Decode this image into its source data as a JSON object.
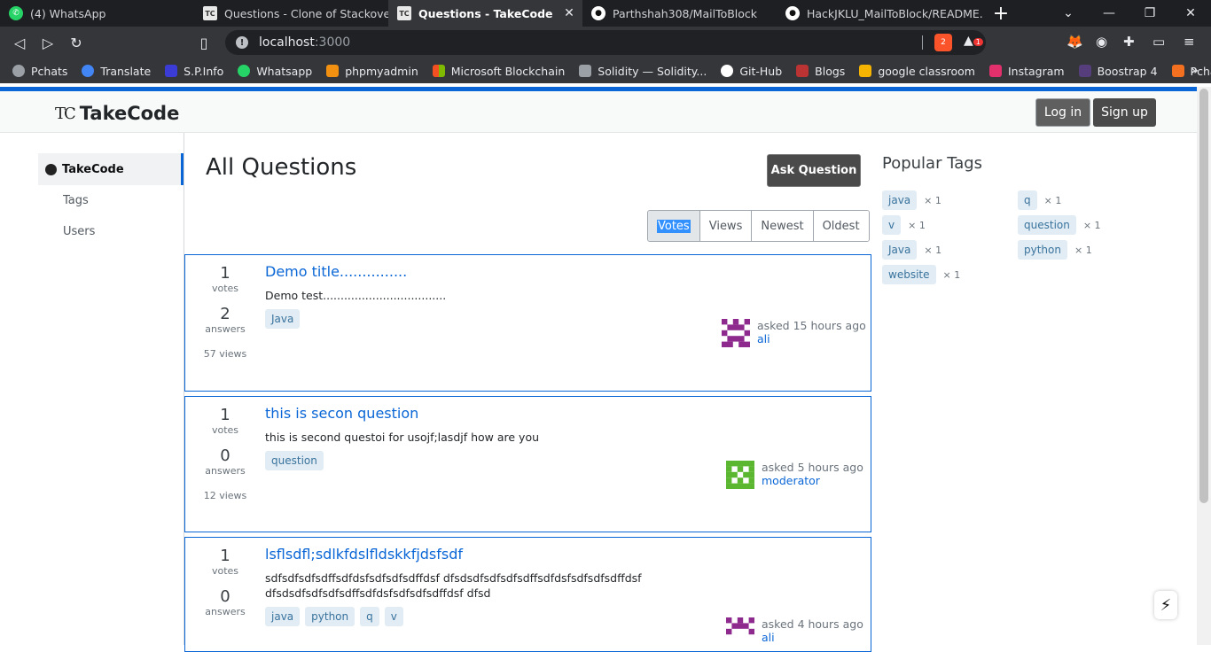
{
  "browser": {
    "tabs": [
      {
        "title": "(4) WhatsApp",
        "favicon": "whatsapp-icon"
      },
      {
        "title": "Questions - Clone of Stackoverflow",
        "favicon": "takecode-icon"
      },
      {
        "title": "Questions - TakeCode",
        "favicon": "takecode-icon",
        "active": true
      },
      {
        "title": "Parthshah308/MailToBlock",
        "favicon": "github-icon"
      },
      {
        "title": "HackJKLU_MailToBlock/README.m",
        "favicon": "github-icon"
      }
    ],
    "url_host": "localhost",
    "url_port": ":3000",
    "brave_count": "2",
    "rewards_count": "1",
    "bookmarks": [
      {
        "label": "Pchats",
        "color": "#9aa0a6"
      },
      {
        "label": "Translate",
        "color": "#4285f4"
      },
      {
        "label": "S.P.Info",
        "color": "#3b3bd6"
      },
      {
        "label": "Whatsapp",
        "color": "#25d366"
      },
      {
        "label": "phpmyadmin",
        "color": "#f29111"
      },
      {
        "label": "Microsoft Blockchain",
        "color": "#00a4ef"
      },
      {
        "label": "Solidity — Solidity...",
        "color": "#9aa0a6"
      },
      {
        "label": "Git-Hub",
        "color": "#ffffff"
      },
      {
        "label": "Blogs",
        "color": "#b33"
      },
      {
        "label": "google classroom",
        "color": "#f4b400"
      },
      {
        "label": "Instagram",
        "color": "#e1306c"
      },
      {
        "label": "Boostrap 4",
        "color": "#563d7c"
      },
      {
        "label": "Pchats",
        "color": "#f37021"
      }
    ]
  },
  "site": {
    "logo_mark": "TC",
    "logo_name": "TakeCode",
    "login": "Log in",
    "signup": "Sign up"
  },
  "nav": {
    "items": [
      "TakeCode",
      "Tags",
      "Users"
    ]
  },
  "main": {
    "title": "All Questions",
    "ask_button": "Ask Question",
    "sort": [
      "Votes",
      "Views",
      "Newest",
      "Oldest"
    ]
  },
  "questions": [
    {
      "votes": "1",
      "votes_label": "votes",
      "answers": "2",
      "answers_label": "answers",
      "views": "57 views",
      "title": "Demo title...............",
      "body": "Demo test...................................",
      "tags": [
        "Java"
      ],
      "asked": "asked 15 hours ago",
      "user": "ali"
    },
    {
      "votes": "1",
      "votes_label": "votes",
      "answers": "0",
      "answers_label": "answers",
      "views": "12 views",
      "title": "this is secon question",
      "body": "this is second questoi  for usojf;lasdjf how are you",
      "tags": [
        "question"
      ],
      "asked": "asked 5 hours ago",
      "user": "moderator"
    },
    {
      "votes": "1",
      "votes_label": "votes",
      "answers": "0",
      "answers_label": "answers",
      "views": "",
      "title": "lsflsdfl;sdlkfdslfldskkfjdsfsdf",
      "body": "sdfsdfsdfsdffsdfdsfsdfsdfsdffdsf dfsdsdfsdfsdfsdffsdfdsfsdfsdfsdffdsf dfsdsdfsdfsdfsdffsdfdsfsdfsdfsdffdsf dfsd",
      "tags": [
        "java",
        "python",
        "q",
        "v"
      ],
      "asked": "asked 4 hours ago",
      "user": "ali"
    }
  ],
  "popular_tags": {
    "title": "Popular Tags",
    "tags": [
      {
        "name": "java",
        "count": "× 1"
      },
      {
        "name": "q",
        "count": "× 1"
      },
      {
        "name": "v",
        "count": "× 1"
      },
      {
        "name": "question",
        "count": "× 1"
      },
      {
        "name": "Java",
        "count": "× 1"
      },
      {
        "name": "python",
        "count": "× 1"
      },
      {
        "name": "website",
        "count": "× 1"
      }
    ]
  },
  "colors": {
    "accent": "#0a66d6",
    "tag_bg": "#e1ecf4",
    "tag_fg": "#39739d"
  }
}
